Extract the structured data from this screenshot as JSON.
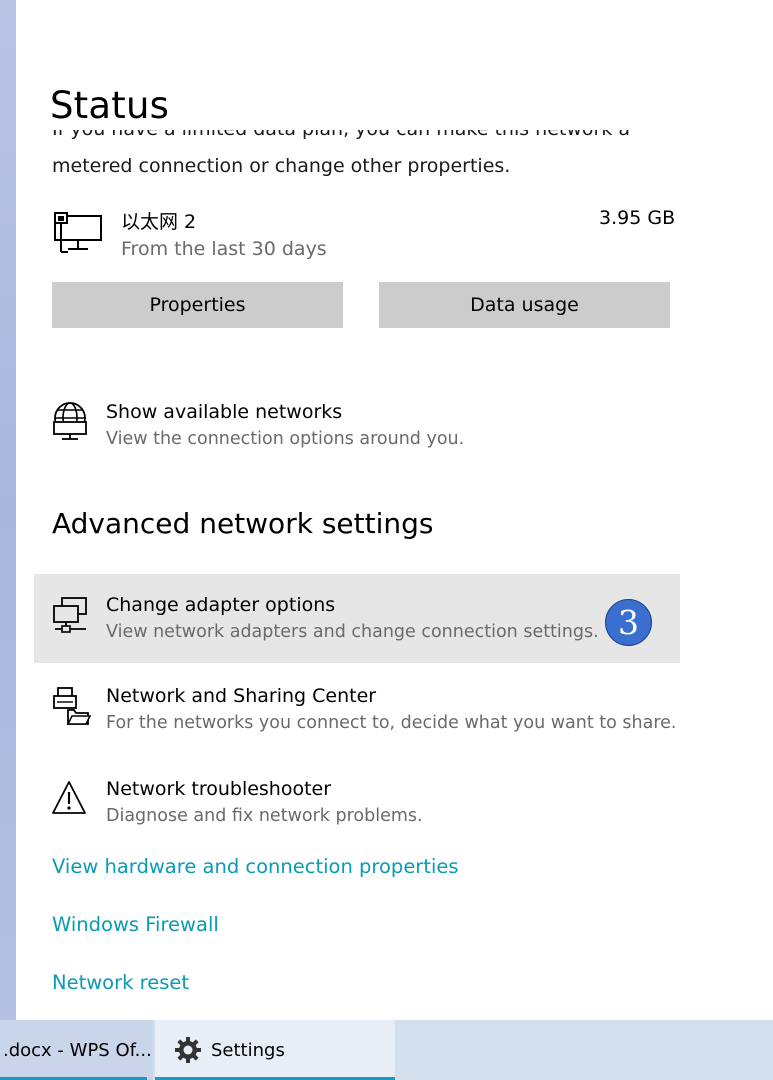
{
  "page": {
    "title": "Status"
  },
  "description": {
    "line1": "If you have a limited data plan, you can make this network a",
    "line2": "metered connection or change other properties."
  },
  "network": {
    "name": "以太网 2",
    "period": "From the last 30 days",
    "usage": "3.95 GB",
    "icon": "ethernet-computer-icon"
  },
  "buttons": {
    "properties": "Properties",
    "data_usage": "Data usage"
  },
  "available_networks": {
    "title": "Show available networks",
    "subtitle": "View the connection options around you.",
    "icon": "globe-network-icon"
  },
  "advanced": {
    "heading": "Advanced network settings",
    "items": [
      {
        "title": "Change adapter options",
        "subtitle": "View network adapters and change connection settings.",
        "icon": "adapter-monitor-icon",
        "highlighted": true,
        "badge": "3"
      },
      {
        "title": "Network and Sharing Center",
        "subtitle": "For the networks you connect to, decide what you want to share.",
        "icon": "sharing-center-icon"
      },
      {
        "title": "Network troubleshooter",
        "subtitle": "Diagnose and fix network problems.",
        "icon": "warning-triangle-icon"
      }
    ]
  },
  "links": {
    "hardware": "View hardware and connection properties",
    "firewall": "Windows Firewall",
    "reset": "Network reset"
  },
  "taskbar": {
    "doc_label": ".docx - WPS Of...",
    "settings_label": "Settings",
    "settings_icon": "gear-icon"
  },
  "colors": {
    "link": "#0a9bb3",
    "button_bg": "#cccccc",
    "highlight_bg": "#e6e6e6",
    "badge": "#3a6fd0",
    "taskbar_accent": "#1e96c8"
  }
}
